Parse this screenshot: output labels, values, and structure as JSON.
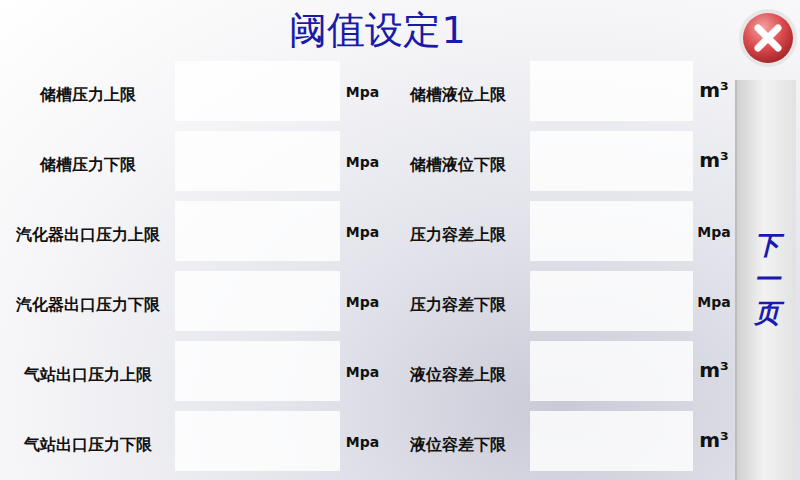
{
  "window": {
    "title": "阈值设定1"
  },
  "rows": [
    {
      "left": {
        "label": "储槽压力上限",
        "value": "",
        "unit": "Mpa"
      },
      "right": {
        "label": "储槽液位上限",
        "value": "",
        "unit": "m³"
      }
    },
    {
      "left": {
        "label": "储槽压力下限",
        "value": "",
        "unit": "Mpa"
      },
      "right": {
        "label": "储槽液位下限",
        "value": "",
        "unit": "m³"
      }
    },
    {
      "left": {
        "label": "汽化器出口压力上限",
        "value": "",
        "unit": "Mpa"
      },
      "right": {
        "label": "压力容差上限",
        "value": "",
        "unit": "Mpa"
      }
    },
    {
      "left": {
        "label": "汽化器出口压力下限",
        "value": "",
        "unit": "Mpa"
      },
      "right": {
        "label": "压力容差下限",
        "value": "",
        "unit": "Mpa"
      }
    },
    {
      "left": {
        "label": "气站出口压力上限",
        "value": "",
        "unit": "Mpa"
      },
      "right": {
        "label": "液位容差上限",
        "value": "",
        "unit": "m³"
      }
    },
    {
      "left": {
        "label": "气站出口压力下限",
        "value": "",
        "unit": "Mpa"
      },
      "right": {
        "label": "液位容差下限",
        "value": "",
        "unit": "m³"
      }
    }
  ],
  "next_button": {
    "label": "下一页"
  }
}
